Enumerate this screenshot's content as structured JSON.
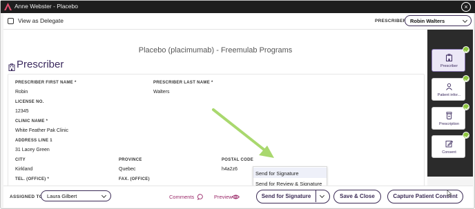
{
  "window": {
    "title": "Anne Webster - Placebo",
    "close_glyph": "×"
  },
  "topbar": {
    "delegate_label": "View as Delegate",
    "delegate_checked": false,
    "prescriber_label": "PRESCRIBER",
    "prescriber_value": "Robin  Walters"
  },
  "main": {
    "program_title": "Placebo (placimumab) - Freemulab Programs",
    "section_title": "Prescriber",
    "fields": {
      "first_name_label": "PRESCRIBER FIRST NAME *",
      "first_name_value": "Robin",
      "last_name_label": "PRESCRIBER LAST NAME *",
      "last_name_value": "Walters",
      "license_label": "LICENSE NO.",
      "license_value": "12345",
      "clinic_label": "CLINIC NAME *",
      "clinic_value": "White Feather Pak Clinic",
      "address_label": "ADDRESS LINE 1",
      "address_value": "31 Lacey Green",
      "city_label": "CITY",
      "city_value": "Kirkland",
      "province_label": "PROVINCE",
      "province_value": "Quebec",
      "postal_label": "POSTAL CODE",
      "postal_value": "h4a2z6",
      "tel_label": "TEL. (OFFICE) *",
      "fax_label": "FAX. (OFFICE)"
    }
  },
  "menu": {
    "items": [
      "Send for Signature",
      "Send for Review & Signature"
    ],
    "highlighted_index": 0
  },
  "sidenav": {
    "items": [
      {
        "label": "Prescriber",
        "icon": "hospital-icon",
        "complete": true,
        "active": true
      },
      {
        "label": "Patient infor...",
        "icon": "person-icon",
        "complete": true,
        "active": false
      },
      {
        "label": "Prescription",
        "icon": "medication-icon",
        "complete": true,
        "active": false
      },
      {
        "label": "Consent",
        "icon": "edit-icon",
        "complete": true,
        "active": false
      }
    ]
  },
  "footer": {
    "assigned_label": "ASSIGNED TO",
    "assigned_value": "Laura  Gilbert",
    "comments_label": "Comments",
    "preview_label": "Preview",
    "send_label": "Send for Signature",
    "save_close_label": "Save & Close",
    "capture_label": "Capture Patient Consent"
  },
  "colors": {
    "brand_purple": "#3b2a5e",
    "link_magenta": "#9b2a6a",
    "check_green": "#8dc63f",
    "annotation_arrow": "#a9d86e",
    "titlebar_bg": "#1e1e1e",
    "sidenav_bg": "#2b2b2b"
  }
}
